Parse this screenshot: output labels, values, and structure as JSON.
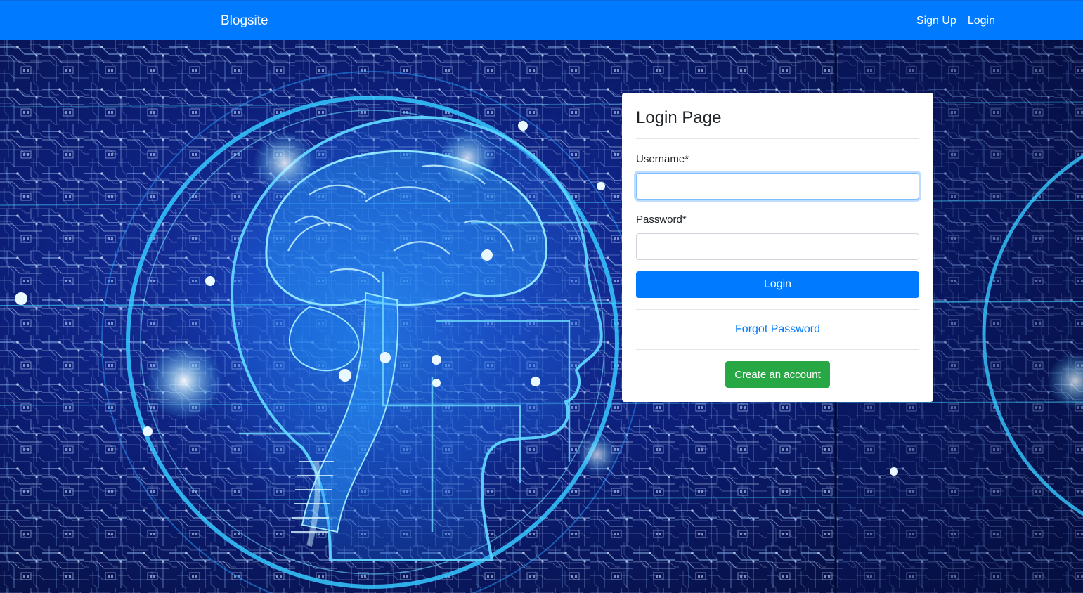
{
  "navbar": {
    "brand": "Blogsite",
    "links": [
      "Sign Up",
      "Login"
    ]
  },
  "login_card": {
    "title": "Login Page",
    "username_label": "Username*",
    "username_value": "",
    "password_label": "Password*",
    "password_value": "",
    "login_button": "Login",
    "forgot_link": "Forgot Password",
    "create_button": "Create an account"
  },
  "colors": {
    "navbar": "#007bff",
    "primary_button": "#007bff",
    "success_button": "#28a745",
    "background": "#06103a",
    "circuit": "#3a8ee8",
    "glow": "#1ec8ff"
  },
  "background_image": {
    "description_icon": "circuit-brain-illustration"
  }
}
